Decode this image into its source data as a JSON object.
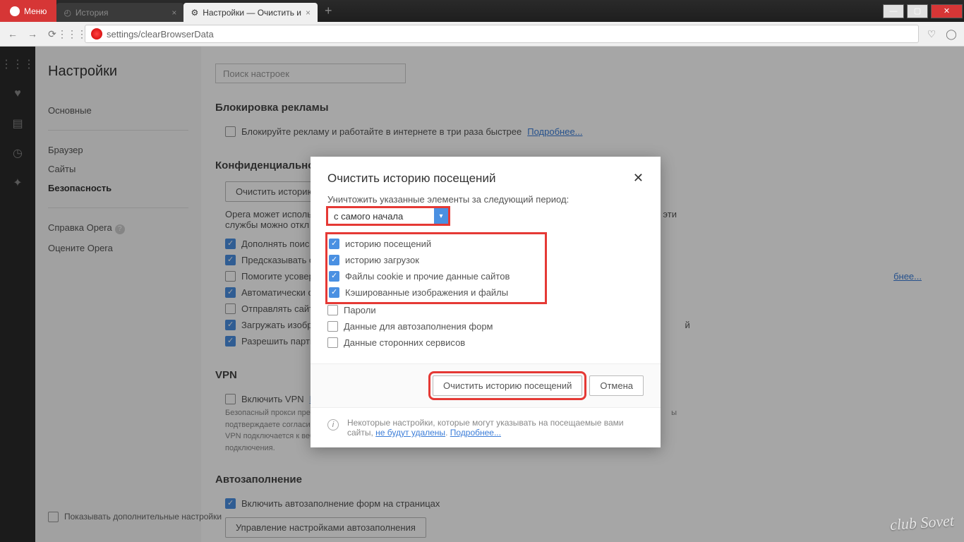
{
  "titlebar": {
    "menu": "Меню"
  },
  "tabs": [
    {
      "label": "История",
      "active": false
    },
    {
      "label": "Настройки — Очистить и",
      "active": true
    }
  ],
  "url": "settings/clearBrowserData",
  "sidebar": {
    "title": "Настройки",
    "items": [
      "Основные",
      "Браузер",
      "Сайты",
      "Безопасность"
    ],
    "help": "Справка Opera",
    "rate": "Оцените Opera",
    "advanced": "Показывать дополнительные настройки"
  },
  "search": {
    "placeholder": "Поиск настроек"
  },
  "sections": {
    "adblock": {
      "title": "Блокировка рекламы",
      "row": "Блокируйте рекламу и работайте в интернете в три раза быстрее",
      "link": "Подробнее..."
    },
    "privacy": {
      "title": "Конфиденциальность",
      "clear_btn": "Очистить историю",
      "desc1": "Opera может использ",
      "desc2": "ости эти",
      "desc3": "службы можно откл",
      "rows": [
        "Дополнять поис",
        "Предсказывать с",
        "Помогите усовер",
        "Автоматически о",
        "Отправлять сайта",
        "Загружать изобр",
        "Разрешить партн"
      ],
      "more": "бнее..."
    },
    "vpn": {
      "title": "VPN",
      "row": "Включить VPN",
      "link": "П",
      "small": "Безопасный прокси пре\nподтверждаете согласие\nVPN подключается к веб-сайтам через различные серверы по всему миру, что может отразиться на скорости подключения.",
      "small2": "ы"
    },
    "autofill": {
      "title": "Автозаполнение",
      "row": "Включить автозаполнение форм на страницах",
      "btn": "Управление настройками автозаполнения"
    }
  },
  "modal": {
    "title": "Очистить историю посещений",
    "period_label": "Уничтожить указанные элементы за следующий период:",
    "period_value": "с самого начала",
    "checks": [
      {
        "label": "историю посещений",
        "checked": true,
        "hl": true
      },
      {
        "label": "историю загрузок",
        "checked": true,
        "hl": true
      },
      {
        "label": "Файлы cookie и прочие данные сайтов",
        "checked": true,
        "hl": true
      },
      {
        "label": "Кэшированные изображения и файлы",
        "checked": true,
        "hl": true
      },
      {
        "label": "Пароли",
        "checked": false,
        "hl": false
      },
      {
        "label": "Данные для автозаполнения форм",
        "checked": false,
        "hl": false
      },
      {
        "label": "Данные сторонних сервисов",
        "checked": false,
        "hl": false
      }
    ],
    "ok": "Очистить историю посещений",
    "cancel": "Отмена",
    "info": "Некоторые настройки, которые могут указывать на посещаемые вами сайты, ",
    "info_link1": "не будут удалены",
    "info_link2": "Подробнее..."
  },
  "watermark": "club Sovet"
}
